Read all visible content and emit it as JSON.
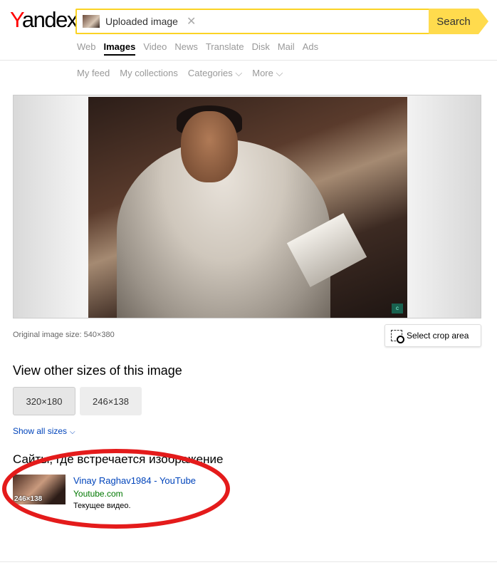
{
  "logo": {
    "y": "Y",
    "rest": "andex"
  },
  "search": {
    "chip_label": "Uploaded image",
    "clear_glyph": "✕",
    "button_label": "Search"
  },
  "services": [
    "Web",
    "Images",
    "Video",
    "News",
    "Translate",
    "Disk",
    "Mail",
    "Ads"
  ],
  "active_service": "Images",
  "subnav": [
    "My feed",
    "My collections",
    "Categories ⌵",
    "More ⌵"
  ],
  "preview": {
    "watermark": "c"
  },
  "original_size_text": "Original image size: 540×380",
  "crop_label": "Select crop area",
  "other_sizes": {
    "heading": "View other sizes of this image",
    "sizes": [
      "320×180",
      "246×138"
    ],
    "show_all": "Show all sizes"
  },
  "sites": {
    "heading": "Сайты, где встречается изображение",
    "results": [
      {
        "thumb_size": "246×138",
        "title": "Vinay Raghav1984 - YouTube",
        "domain": "Youtube.com",
        "description": "Текущее видео."
      }
    ]
  },
  "colors": {
    "accent_yellow": "#ffdb4d",
    "link_blue": "#0044bb",
    "url_green": "#007700",
    "annotation_red": "#e41b1b"
  }
}
